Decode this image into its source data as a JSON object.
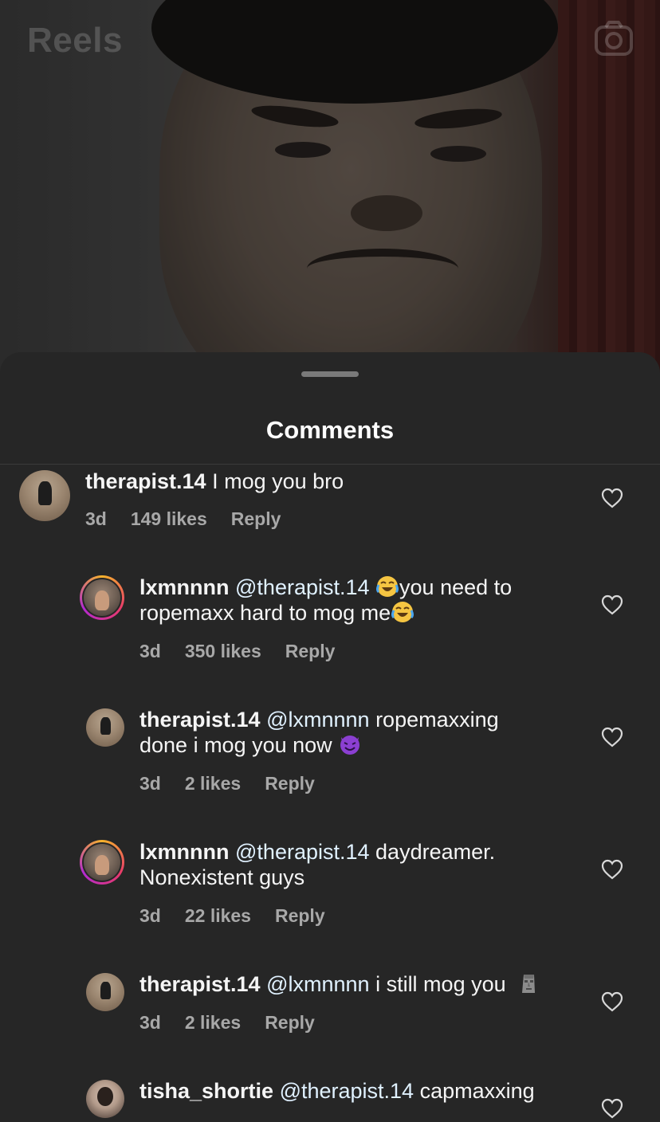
{
  "header": {
    "title": "Reels",
    "camera_icon": "camera-icon"
  },
  "sheet": {
    "title": "Comments"
  },
  "comments": [
    {
      "username": "therapist.14",
      "text": "I mog you bro",
      "age": "3d",
      "likes": "149 likes",
      "reply": "Reply",
      "avatar": "therapist"
    },
    {
      "username": "lxmnnnn",
      "mention": "@therapist.14",
      "text_a": "you need to",
      "text_b": "ropemaxx hard to mog me",
      "emoji": "face-with-tears-of-joy",
      "age": "3d",
      "likes": "350 likes",
      "reply": "Reply",
      "avatar": "lxmnnnn"
    },
    {
      "username": "therapist.14",
      "mention": "@lxmnnnn",
      "text_a": "ropemaxxing",
      "text_b": "done i mog you now",
      "emoji": "smiling-face-with-horns",
      "age": "3d",
      "likes": "2 likes",
      "reply": "Reply",
      "avatar": "therapist"
    },
    {
      "username": "lxmnnnn",
      "mention": "@therapist.14",
      "text_a": "daydreamer.",
      "text_b": "Nonexistent guys",
      "age": "3d",
      "likes": "22 likes",
      "reply": "Reply",
      "avatar": "lxmnnnn"
    },
    {
      "username": "therapist.14",
      "mention": "@lxmnnnn",
      "text_a": "i still mog you",
      "emoji": "moai",
      "age": "3d",
      "likes": "2 likes",
      "reply": "Reply",
      "avatar": "therapist"
    },
    {
      "username": "tisha_shortie",
      "mention": "@therapist.14",
      "text_a": "capmaxxing",
      "avatar": "tisha"
    }
  ],
  "colors": {
    "sheet_bg": "#262626",
    "text": "#f5f5f5",
    "muted": "#a8a8a8",
    "mention": "#e0f1ff"
  }
}
